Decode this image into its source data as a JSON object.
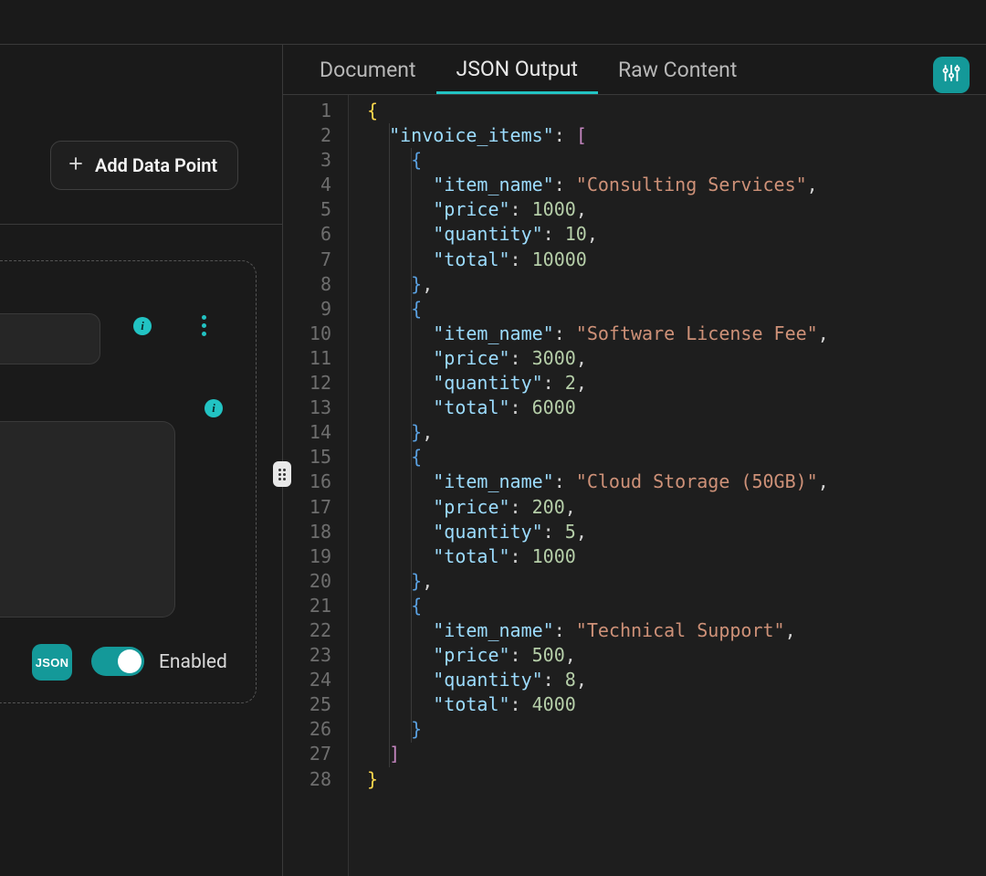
{
  "sidebar": {
    "add_button_label": "Add Data Point",
    "json_tag": "JSON",
    "enabled_label": "Enabled",
    "toggle_on": true
  },
  "tabs": [
    {
      "label": "Document",
      "active": false
    },
    {
      "label": "JSON Output",
      "active": true
    },
    {
      "label": "Raw Content",
      "active": false
    }
  ],
  "json_output": {
    "invoice_items": [
      {
        "item_name": "Consulting Services",
        "price": 1000,
        "quantity": 10,
        "total": 10000
      },
      {
        "item_name": "Software License Fee",
        "price": 3000,
        "quantity": 2,
        "total": 6000
      },
      {
        "item_name": "Cloud Storage (50GB)",
        "price": 200,
        "quantity": 5,
        "total": 1000
      },
      {
        "item_name": "Technical Support",
        "price": 500,
        "quantity": 8,
        "total": 4000
      }
    ]
  },
  "keys": {
    "root_key": "invoice_items",
    "item_name": "item_name",
    "price": "price",
    "quantity": "quantity",
    "total": "total"
  }
}
